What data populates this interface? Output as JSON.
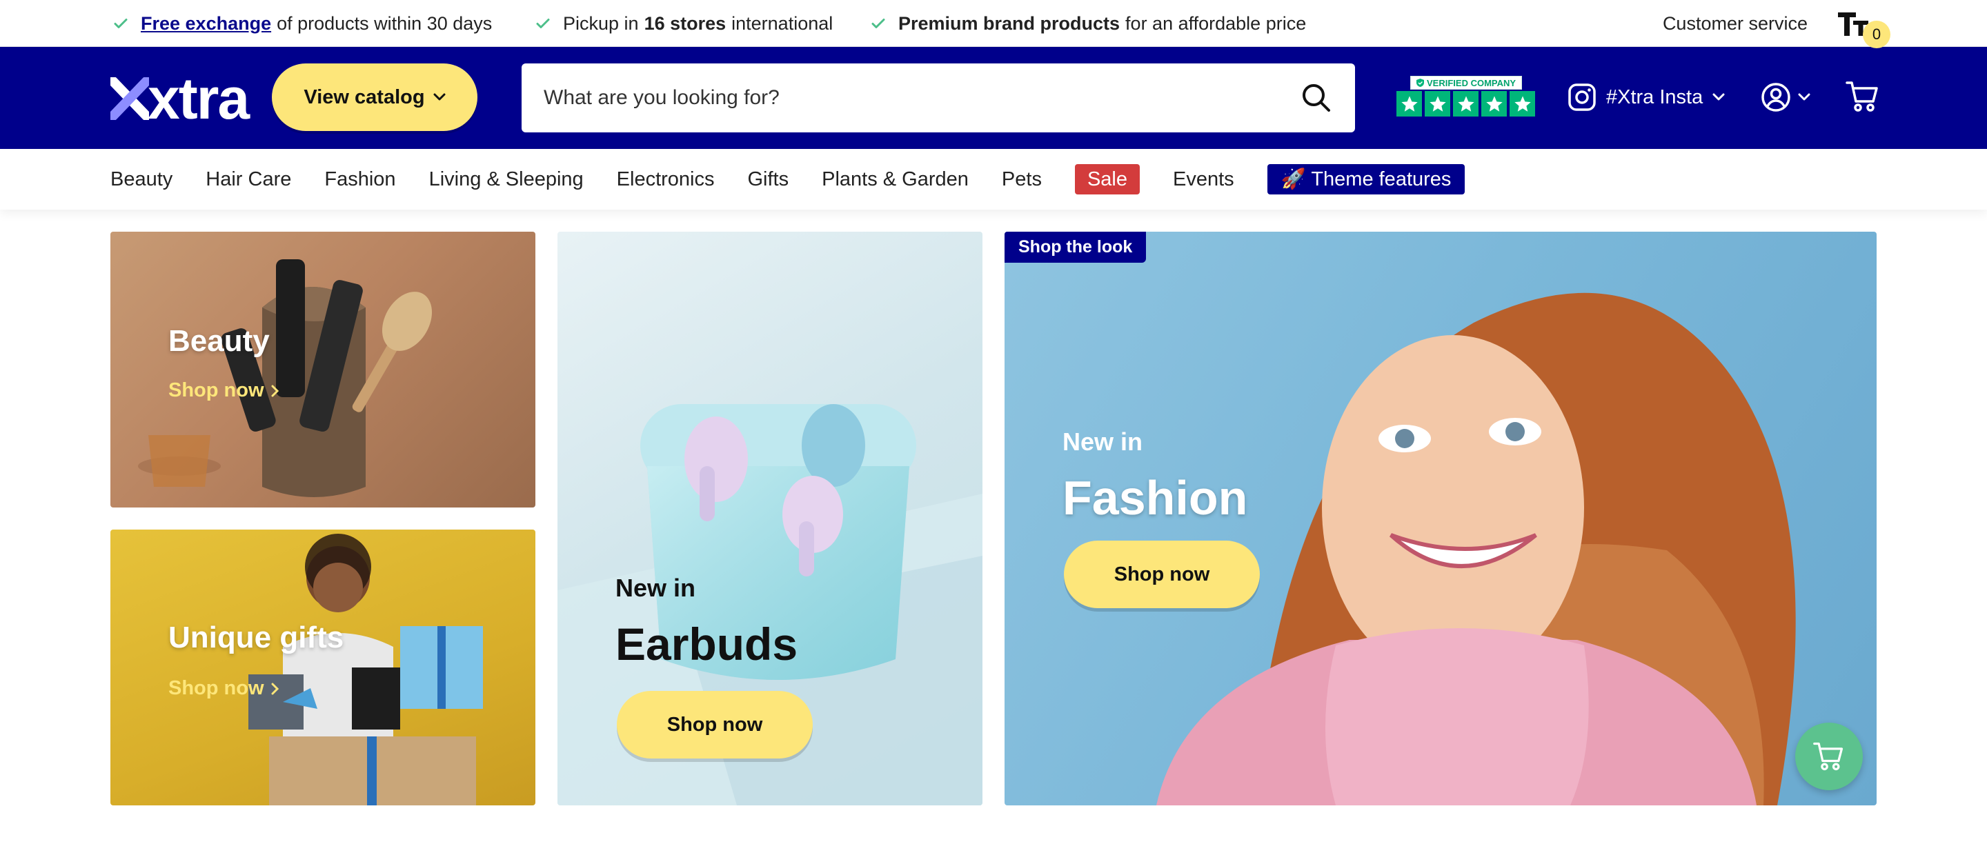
{
  "usps": [
    {
      "link": "Free exchange",
      "text": "of products within 30 days"
    },
    {
      "pre": "Pickup in",
      "bold": "16 stores",
      "text": "international"
    },
    {
      "bold": "Premium brand products",
      "text": "for an affordable price"
    }
  ],
  "topbar": {
    "customer_service": "Customer service",
    "text_size_icon": "text-size-icon"
  },
  "header": {
    "logo": "xtra",
    "catalog_button": "View catalog",
    "search_placeholder": "What are you looking for?",
    "trust_badge": "VERIFIED COMPANY",
    "instagram_label": "#Xtra Insta",
    "cart_count": "0"
  },
  "nav": {
    "items": [
      "Beauty",
      "Hair Care",
      "Fashion",
      "Living & Sleeping",
      "Electronics",
      "Gifts",
      "Plants & Garden",
      "Pets",
      "Sale",
      "Events",
      "🚀 Theme features"
    ]
  },
  "tiles": {
    "beauty": {
      "title": "Beauty",
      "link": "Shop now"
    },
    "gifts": {
      "title": "Unique gifts",
      "link": "Shop now"
    },
    "earbuds": {
      "kicker": "New in",
      "title": "Earbuds",
      "button": "Shop now"
    },
    "fashion": {
      "badge": "Shop the look",
      "kicker": "New in",
      "title": "Fashion",
      "button": "Shop now"
    }
  },
  "colors": {
    "brand_blue": "#00008b",
    "accent_yellow": "#fde67a",
    "check_green": "#4dbf8a",
    "sale_red": "#d33c3c"
  }
}
